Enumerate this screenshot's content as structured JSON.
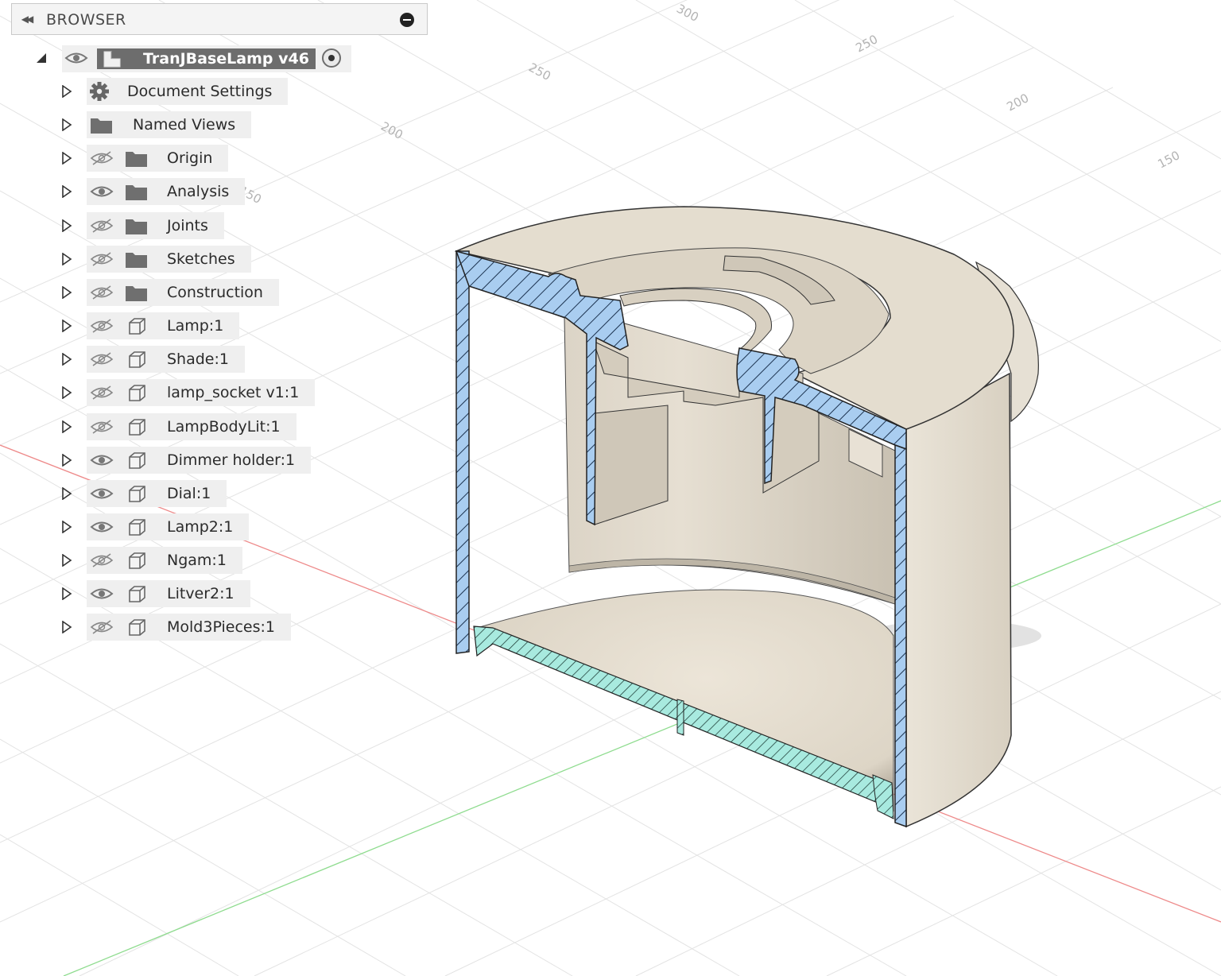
{
  "browser": {
    "title": "BROWSER",
    "collapse_icon": "double-chevron-left-icon",
    "minimize_icon": "minus-circle-icon"
  },
  "root": {
    "label": "TranJBaseLamp v46",
    "visible": true
  },
  "tree": [
    {
      "label": "Document Settings",
      "icon": "gear-icon",
      "eye": "none"
    },
    {
      "label": "Named Views",
      "icon": "folder-icon",
      "eye": "none"
    },
    {
      "label": "Origin",
      "icon": "folder-icon",
      "eye": "hidden"
    },
    {
      "label": "Analysis",
      "icon": "folder-icon",
      "eye": "visible"
    },
    {
      "label": "Joints",
      "icon": "folder-icon",
      "eye": "hidden"
    },
    {
      "label": "Sketches",
      "icon": "folder-icon",
      "eye": "hidden"
    },
    {
      "label": "Construction",
      "icon": "folder-icon",
      "eye": "hidden"
    },
    {
      "label": "Lamp:1",
      "icon": "component-icon",
      "eye": "hidden"
    },
    {
      "label": "Shade:1",
      "icon": "component-icon",
      "eye": "hidden"
    },
    {
      "label": "lamp_socket v1:1",
      "icon": "component-icon",
      "eye": "hidden"
    },
    {
      "label": "LampBodyLit:1",
      "icon": "component-icon",
      "eye": "hidden"
    },
    {
      "label": "Dimmer holder:1",
      "icon": "component-icon",
      "eye": "visible"
    },
    {
      "label": "Dial:1",
      "icon": "component-icon",
      "eye": "visible"
    },
    {
      "label": "Lamp2:1",
      "icon": "component-icon",
      "eye": "visible"
    },
    {
      "label": "Ngam:1",
      "icon": "component-icon",
      "eye": "hidden"
    },
    {
      "label": "Litver2:1",
      "icon": "component-icon",
      "eye": "visible"
    },
    {
      "label": "Mold3Pieces:1",
      "icon": "component-icon",
      "eye": "hidden"
    }
  ],
  "grid_labels": [
    "300",
    "250",
    "250",
    "200",
    "200",
    "150",
    "150"
  ],
  "colors": {
    "section_fill": "#a9cdf0",
    "section_fill_secondary": "#a8eadf",
    "model_surface": "#e4ddcf",
    "grid_line": "#e3e3e3",
    "axis_x": "#ee8a8a",
    "axis_y": "#8fdc8f"
  }
}
